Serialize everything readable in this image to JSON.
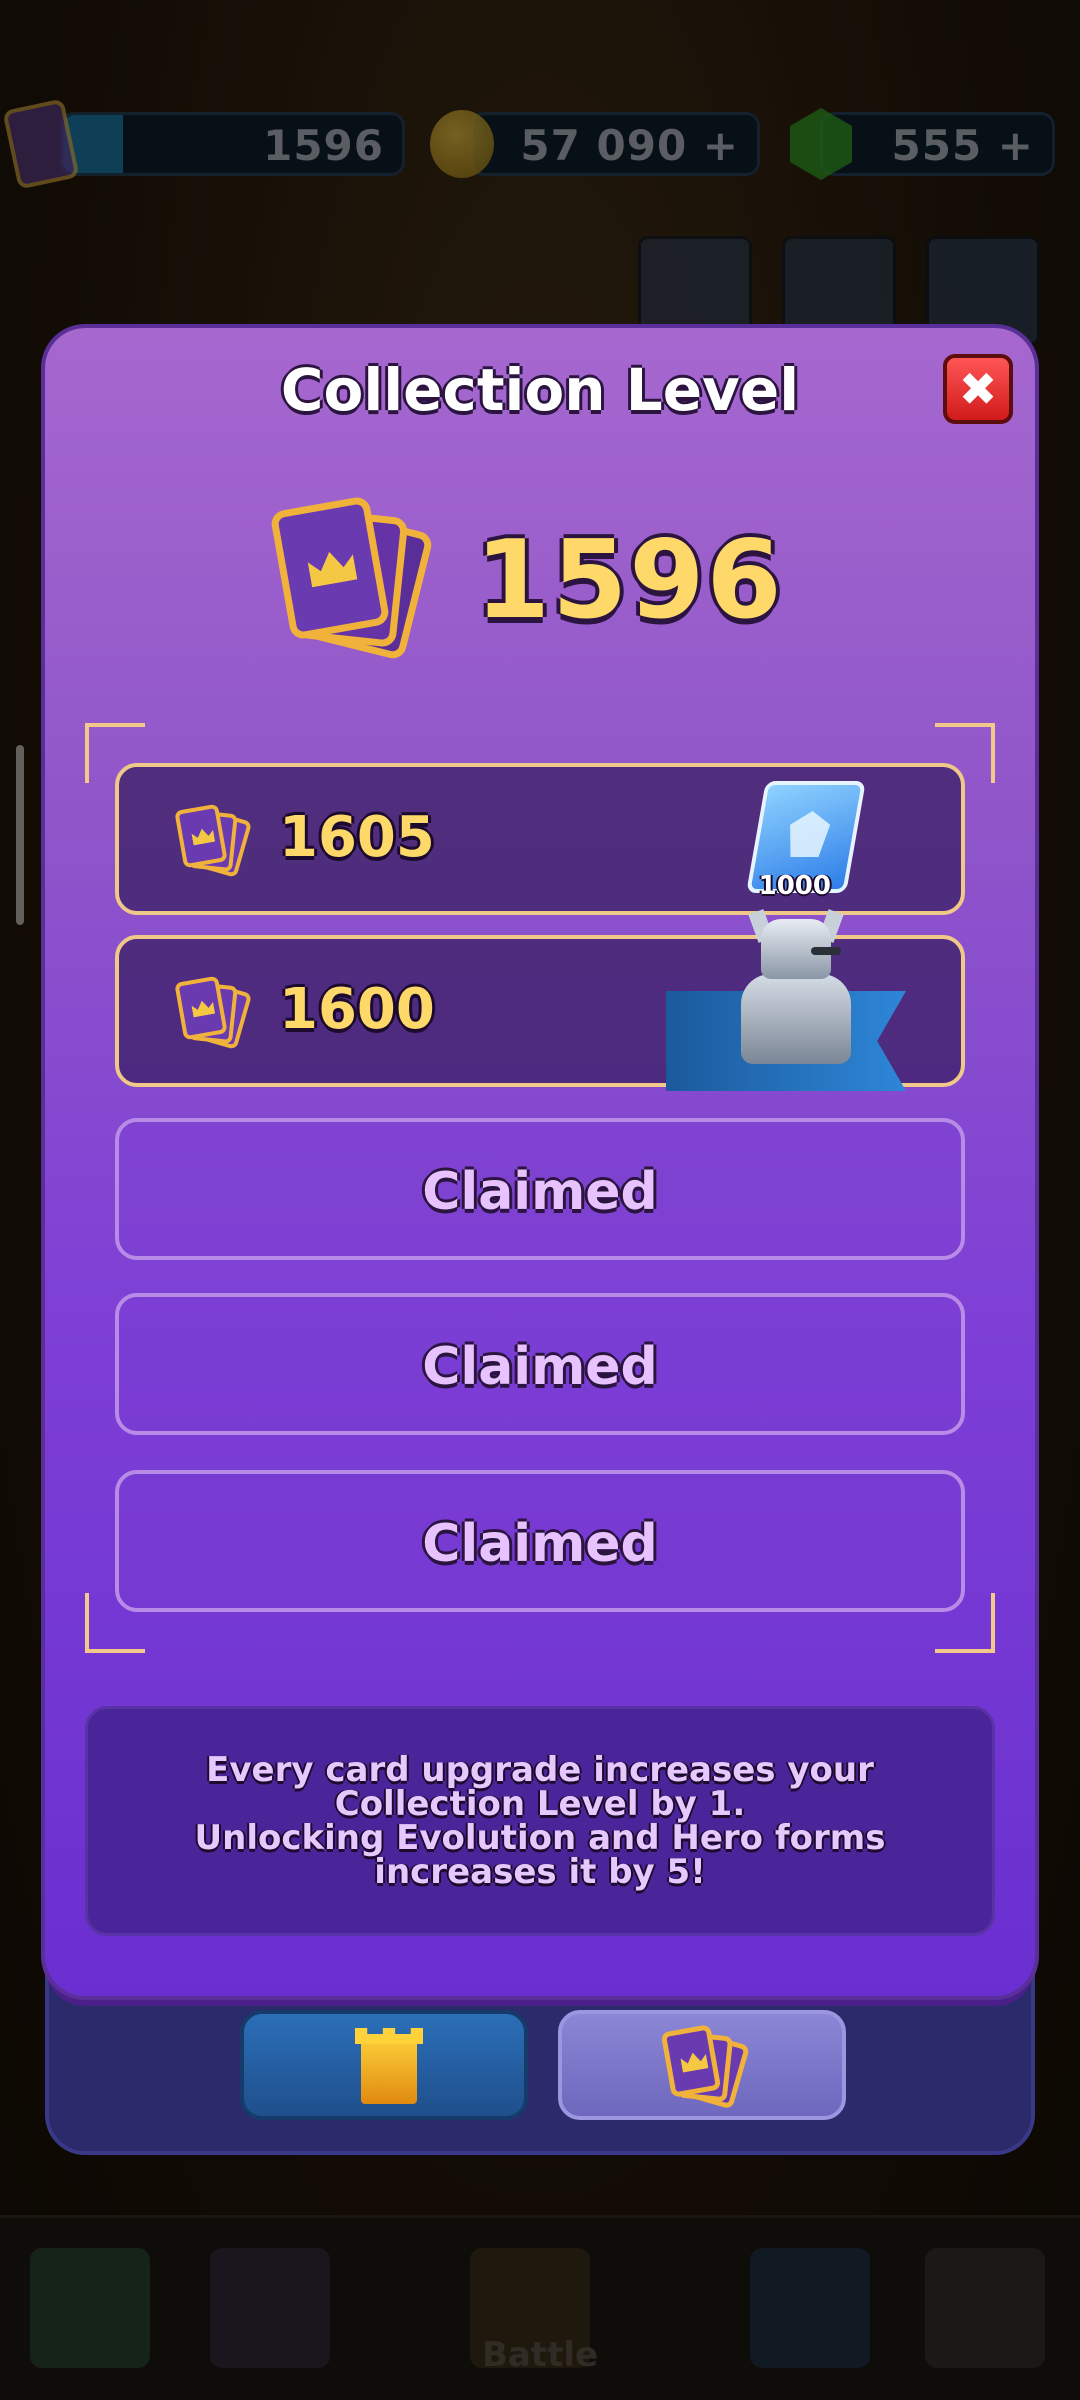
{
  "topbar": {
    "cards_value": "1596",
    "gold_value": "57 090",
    "gems_value": "555",
    "plus_label": "+",
    "cards_icon": "cards-icon",
    "gold_icon": "coin-icon",
    "gems_icon": "gem-icon"
  },
  "modal": {
    "title": "Collection Level",
    "close_label": "✖",
    "current_level": "1596",
    "rows": [
      {
        "status": "pending",
        "requirement": "1605",
        "reward": "book",
        "reward_amount": "1000"
      },
      {
        "status": "pending",
        "requirement": "1600",
        "reward": "pekka-banner"
      },
      {
        "status": "claimed",
        "label": "Claimed"
      },
      {
        "status": "claimed",
        "label": "Claimed"
      },
      {
        "status": "claimed",
        "label": "Claimed"
      }
    ],
    "info_text": "Every card upgrade increases your\nCollection Level by 1.\nUnlocking Evolution and Hero forms\nincreases it by 5!",
    "tabs": [
      {
        "icon": "tower-icon",
        "active": false
      },
      {
        "icon": "cards-icon",
        "active": true
      }
    ]
  },
  "bottom_nav": {
    "battle_label": "Battle"
  },
  "colors": {
    "modal_top": "#a668cf",
    "modal_bottom": "#6a2fd0",
    "gold_text": "#ffd86a",
    "claimed_text": "#e7c2ff"
  }
}
